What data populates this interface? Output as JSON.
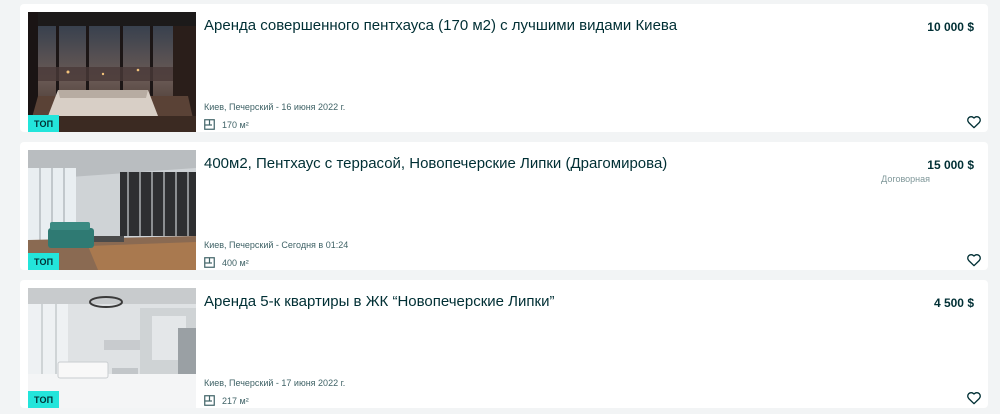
{
  "listings": [
    {
      "title": "Аренда совершенного пентхауса (170 м2) с лучшими видами Киева",
      "price": "10 000 $",
      "negotiable": "",
      "location": "Киев, Печерский - 16 июня 2022 г.",
      "area": "170 м²",
      "badge": "ТОП",
      "icons": {
        "area": "floor-plan-icon",
        "favorite": "heart-outline-icon"
      }
    },
    {
      "title": "400м2, Пентхаус с террасой, Новопечерские Липки (Драгомирова)",
      "price": "15 000 $",
      "negotiable": "Договорная",
      "location": "Киев, Печерский - Сегодня в 01:24",
      "area": "400 м²",
      "badge": "ТОП",
      "icons": {
        "area": "floor-plan-icon",
        "favorite": "heart-outline-icon"
      }
    },
    {
      "title": "Аренда 5-к квартиры в ЖК “Новопечерские Липки”",
      "price": "4 500 $",
      "negotiable": "",
      "location": "Киев, Печерский - 17 июня 2022 г.",
      "area": "217 м²",
      "badge": "ТОП",
      "icons": {
        "area": "floor-plan-icon",
        "favorite": "heart-outline-icon"
      }
    }
  ],
  "colors": {
    "background": "#f2f4f5",
    "card": "#ffffff",
    "text": "#002f34",
    "muted": "#406367",
    "badge": "#23e5db"
  }
}
